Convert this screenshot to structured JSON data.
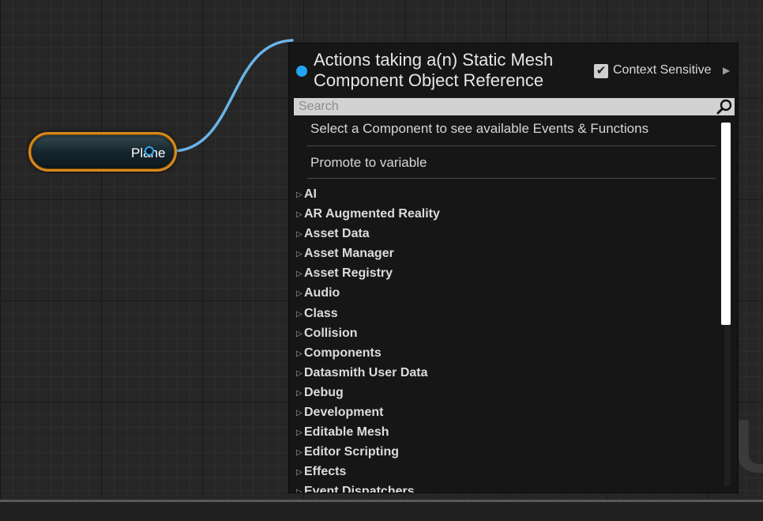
{
  "node": {
    "label": "Plane",
    "border_color": "#d9881a",
    "pin_color": "#2ea7f0",
    "wire_color": "#6ab4e8"
  },
  "panel": {
    "title_line1": "Actions taking a(n) Static Mesh",
    "title_line2": "Component Object Reference",
    "context_sensitive_label": "Context Sensitive",
    "context_sensitive_checked": true,
    "search_placeholder": "Search",
    "entries": [
      "Select a Component to see available Events & Functions",
      "Promote to variable"
    ],
    "categories": [
      "AI",
      "AR Augmented Reality",
      "Asset Data",
      "Asset Manager",
      "Asset Registry",
      "Audio",
      "Class",
      "Collision",
      "Components",
      "Datasmith User Data",
      "Debug",
      "Development",
      "Editable Mesh",
      "Editor Scripting",
      "Effects",
      "Event Dispatchers"
    ]
  },
  "icons": {
    "search": "search-icon",
    "checkbox": "checkmark-icon",
    "expand": "triangle-right-icon",
    "pin": "object-pin-icon"
  }
}
